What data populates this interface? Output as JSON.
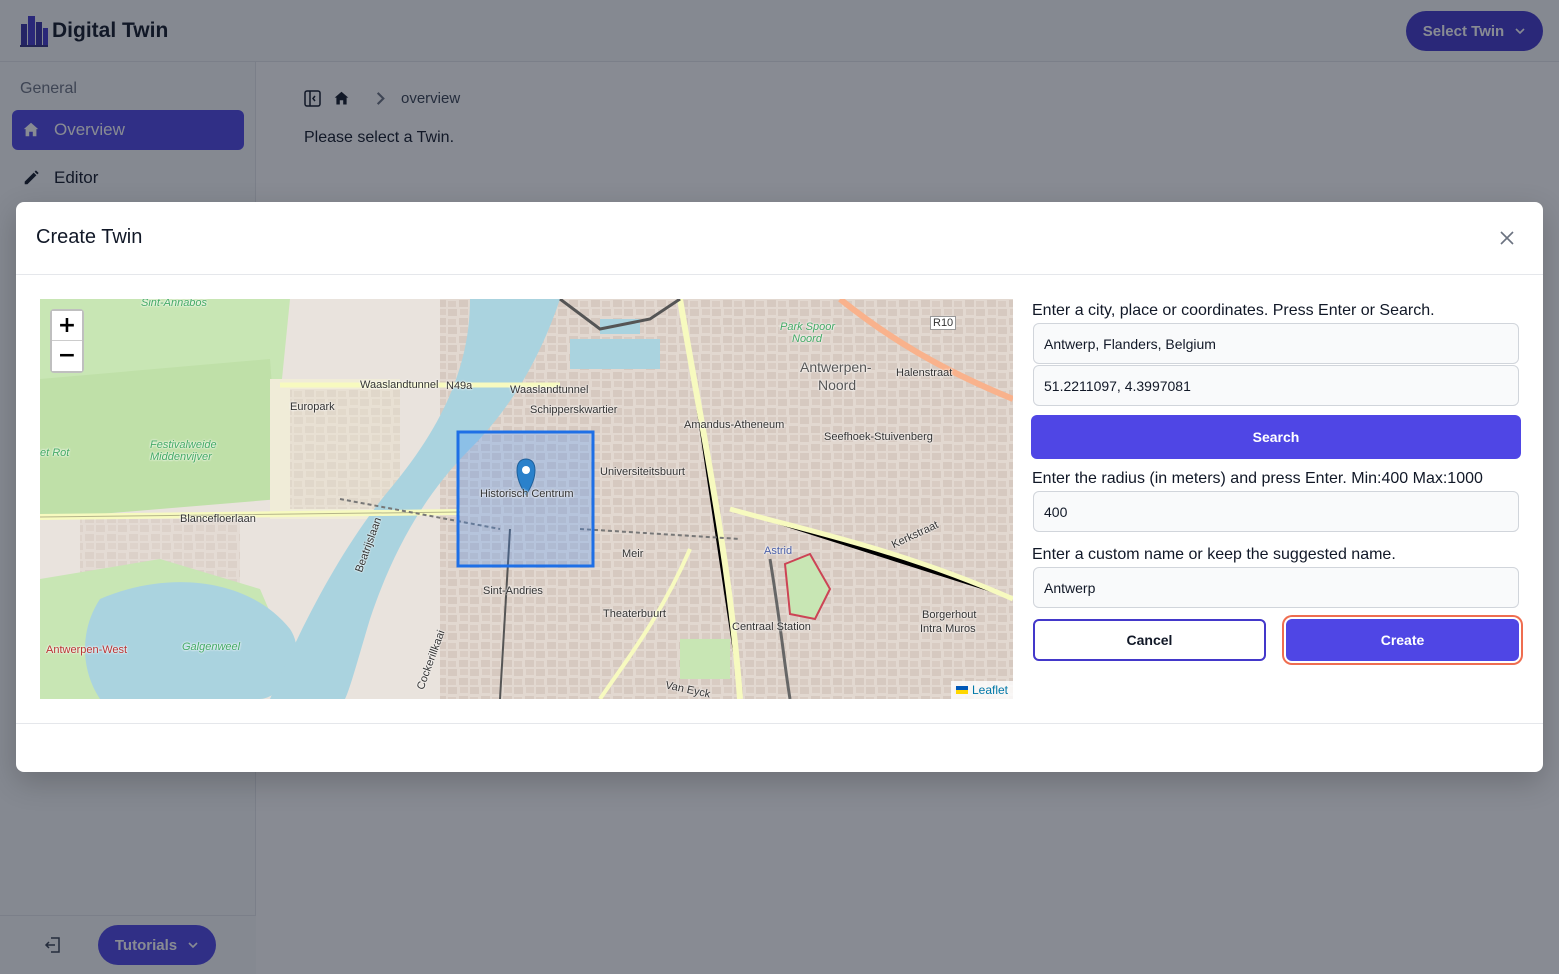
{
  "app": {
    "title": "Digital Twin",
    "select_twin_label": "Select Twin"
  },
  "sidebar": {
    "section_label": "General",
    "items": [
      {
        "label": "Overview",
        "icon": "home-icon",
        "active": true
      },
      {
        "label": "Editor",
        "icon": "pencil-icon",
        "active": false
      }
    ],
    "tutorials_label": "Tutorials"
  },
  "breadcrumb": {
    "current": "overview"
  },
  "main": {
    "message": "Please select a Twin."
  },
  "modal": {
    "title": "Create Twin",
    "location_label": "Enter a city, place or coordinates. Press Enter or Search.",
    "location_value": "Antwerp, Flanders, Belgium",
    "coordinates_value": "51.2211097, 4.3997081",
    "search_label": "Search",
    "radius_label": "Enter the radius (in meters) and press Enter. Min:400 Max:1000",
    "radius_value": "400",
    "name_label": "Enter a custom name or keep the suggested name.",
    "name_value": "Antwerp",
    "cancel_label": "Cancel",
    "create_label": "Create"
  },
  "map": {
    "zoom_in": "+",
    "zoom_out": "−",
    "attribution": "Leaflet",
    "labels": {
      "sint_annabos": "Sint-Annabos",
      "waaslandtunnel_1": "Waaslandtunnel",
      "waaslandtunnel_2": "Waaslandtunnel",
      "n49a": "N49a",
      "europark": "Europark",
      "schipperskwartier": "Schipperskwartier",
      "festivalweide": "Festivalweide",
      "middenvijver": "Middenvijver",
      "et_rot": "et Rot",
      "historisch_centrum": "Historisch Centrum",
      "universiteitsbuurt": "Universiteitsbuurt",
      "amandus_atheneum": "Amandus-Atheneum",
      "seefhoek": "Seefhoek-Stuivenberg",
      "antwerpen_noord_1": "Antwerpen-",
      "antwerpen_noord_2": "Noord",
      "park_spoor_1": "Park Spoor",
      "park_spoor_2": "Noord",
      "r10": "R10",
      "blancefloerlaan": "Blancefloerlaan",
      "beatrijslaan": "Beatrijslaan",
      "sint_andries": "Sint-Andries",
      "meir": "Meir",
      "astrid": "Astrid",
      "theaterbuurt": "Theaterbuurt",
      "centraal_station": "Centraal Station",
      "borgerhout_1": "Borgerhout",
      "borgerhout_2": "Intra Muros",
      "galgenweel": "Galgenweel",
      "antwerpen_west": "Antwerpen-West",
      "kerkstraat": "Kerkstraat",
      "halenstraat": "Halenstraat",
      "cockerillkaai": "Cockerillkaai",
      "van_eyck": "Van Eyck"
    }
  },
  "colors": {
    "primary": "#4f46e5",
    "primary_dark": "#4338ca",
    "create_ring": "#ef6d50",
    "river": "#aad3df",
    "selection": "#1e6fe6"
  }
}
